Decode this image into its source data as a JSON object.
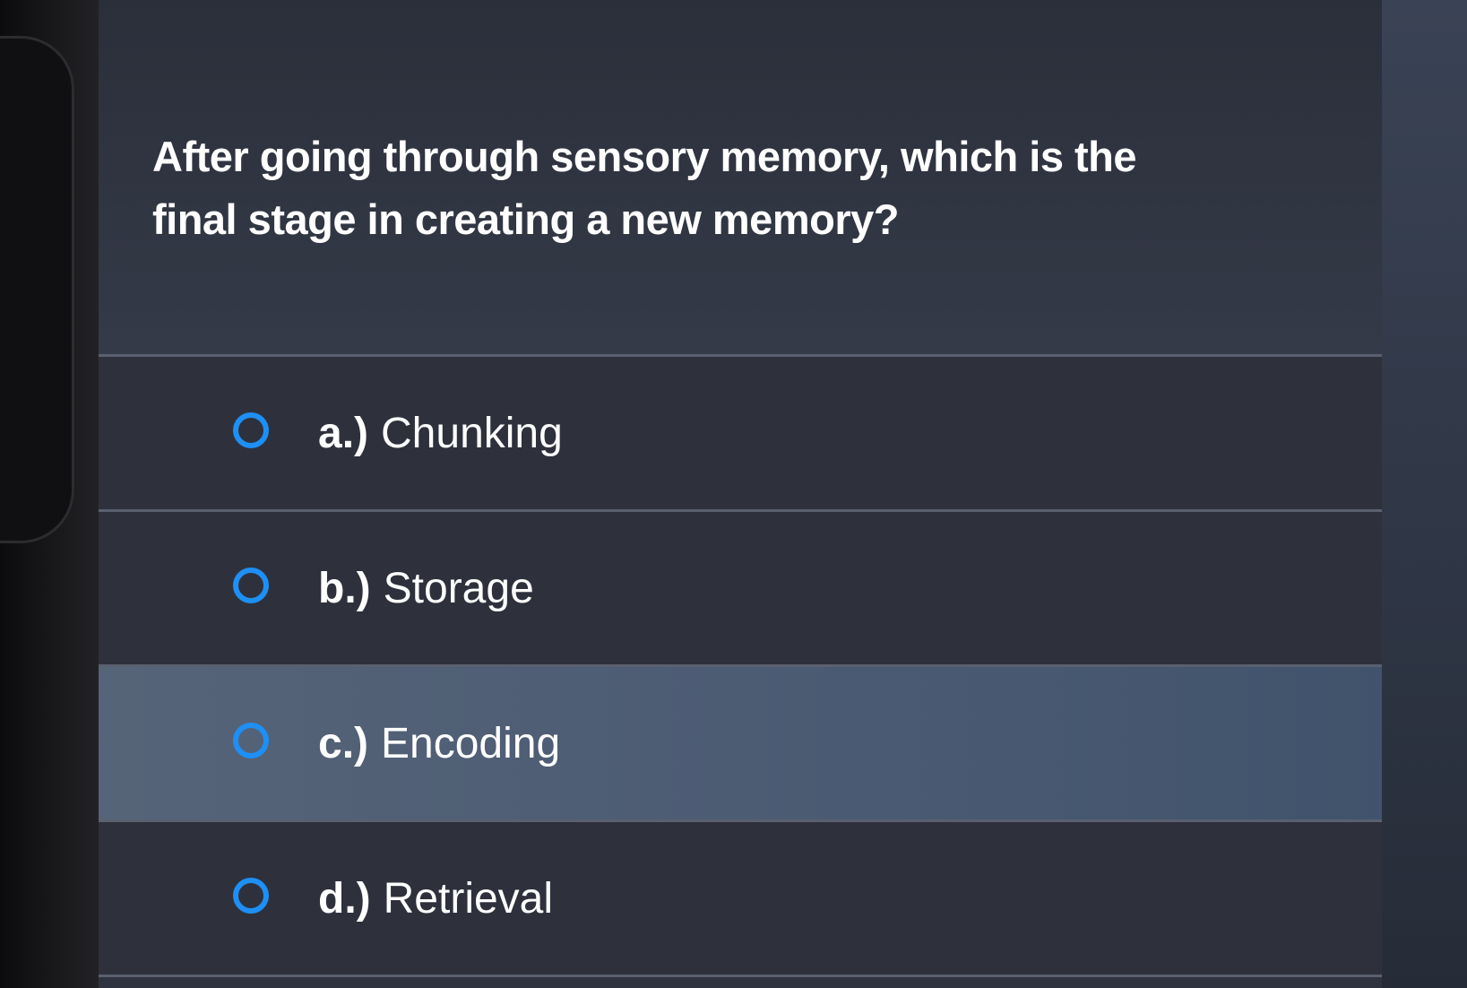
{
  "quiz": {
    "question": "After going through sensory memory, which is the final stage in creating a new memory?",
    "options": [
      {
        "letter": "a.)",
        "text": "Chunking"
      },
      {
        "letter": "b.)",
        "text": "Storage"
      },
      {
        "letter": "c.)",
        "text": "Encoding"
      },
      {
        "letter": "d.)",
        "text": "Retrieval"
      }
    ]
  },
  "colors": {
    "radio_accent": "#1e8ff5",
    "highlight_row": "#566478",
    "background": "#2e313c"
  },
  "icons": {
    "option_marker": "radio-unselected-icon"
  }
}
